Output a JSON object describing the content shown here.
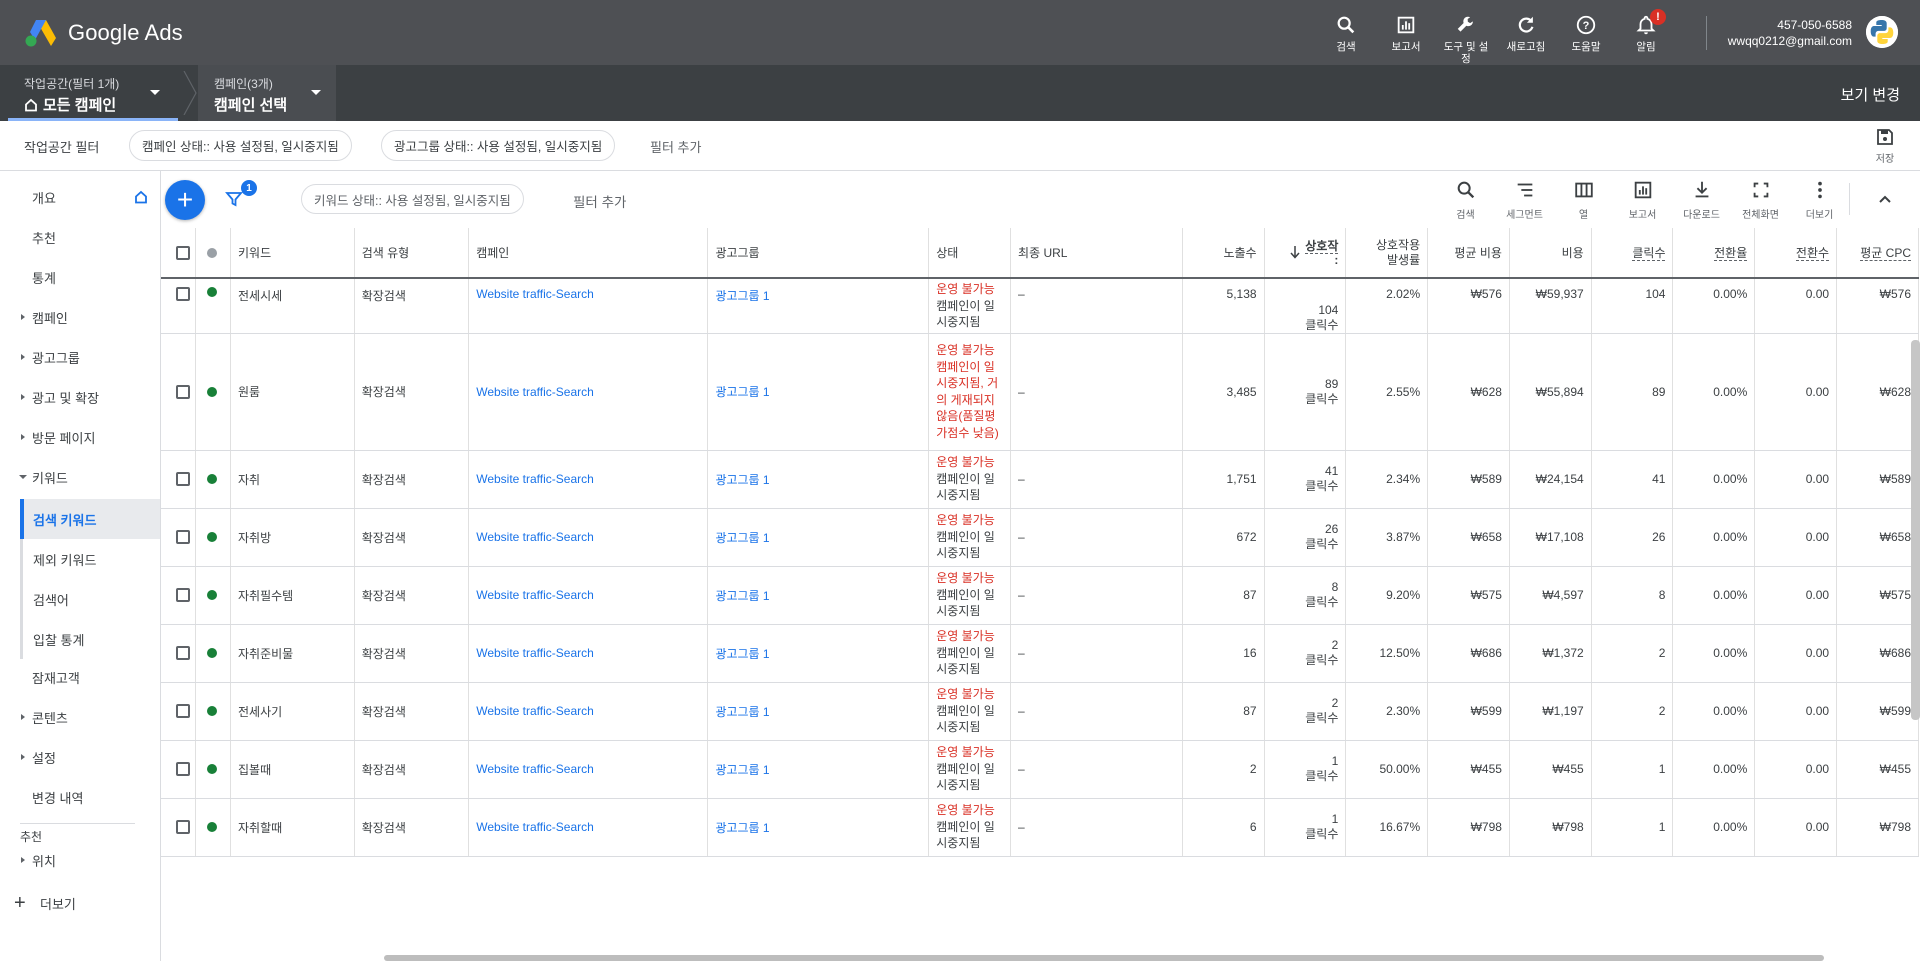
{
  "app": {
    "name": "Google Ads"
  },
  "top_actions": [
    {
      "label": "검색",
      "icon": "search-icon"
    },
    {
      "label": "보고서",
      "icon": "report-icon"
    },
    {
      "label": "도구 및 설정",
      "icon": "wrench-icon"
    },
    {
      "label": "새로고침",
      "icon": "refresh-icon"
    },
    {
      "label": "도움말",
      "icon": "help-icon"
    },
    {
      "label": "알림",
      "icon": "bell-icon",
      "badge": "!"
    }
  ],
  "account": {
    "id": "457-050-6588",
    "email": "wwqq0212@gmail.com"
  },
  "nav": {
    "workspace_small": "작업공간(필터 1개)",
    "workspace_big": "모든 캠페인",
    "campaign_small": "캠페인(3개)",
    "campaign_big": "캠페인 선택",
    "view_change": "보기 변경"
  },
  "workspace_filter": {
    "title": "작업공간 필터",
    "chips": [
      "캠페인 상태:: 사용 설정됨, 일시중지됨",
      "광고그룹 상태:: 사용 설정됨, 일시중지됨"
    ],
    "add_filter": "필터 추가",
    "save_label": "저장"
  },
  "sidebar": {
    "items": [
      {
        "label": "개요",
        "type": "top"
      },
      {
        "label": "추천",
        "type": "top"
      },
      {
        "label": "통계",
        "type": "top"
      },
      {
        "label": "캠페인",
        "type": "expand"
      },
      {
        "label": "광고그룹",
        "type": "expand"
      },
      {
        "label": "광고 및 확장",
        "type": "expand"
      },
      {
        "label": "방문 페이지",
        "type": "expand"
      },
      {
        "label": "키워드",
        "type": "expanded"
      }
    ],
    "sub_items": [
      {
        "label": "검색 키워드",
        "active": true
      },
      {
        "label": "제외 키워드",
        "active": false
      },
      {
        "label": "검색어",
        "active": false
      },
      {
        "label": "입찰 통계",
        "active": false
      }
    ],
    "items2": [
      {
        "label": "잠재고객",
        "type": "top"
      },
      {
        "label": "콘텐츠",
        "type": "expand"
      },
      {
        "label": "설정",
        "type": "expand"
      },
      {
        "label": "변경 내역",
        "type": "top"
      }
    ],
    "section_label": "추천",
    "section_item": "위치",
    "more": "더보기"
  },
  "table_toolbar": {
    "filter_badge": "1",
    "keyword_chip": "키워드 상태:: 사용 설정됨, 일시중지됨",
    "add_filter": "필터 추가",
    "tools": [
      {
        "label": "검색",
        "icon": "search-icon"
      },
      {
        "label": "세그먼트",
        "icon": "segment-icon"
      },
      {
        "label": "열",
        "icon": "columns-icon"
      },
      {
        "label": "보고서",
        "icon": "report-icon"
      },
      {
        "label": "다운로드",
        "icon": "download-icon"
      },
      {
        "label": "전체화면",
        "icon": "fullscreen-icon"
      },
      {
        "label": "더보기",
        "icon": "more-vert-icon"
      }
    ]
  },
  "table": {
    "headers": {
      "keyword": "키워드",
      "match_type": "검색 유형",
      "campaign": "캠페인",
      "ad_group": "광고그룹",
      "status": "상태",
      "final_url": "최종 URL",
      "impressions": "노출수",
      "interactions": "상호작",
      "interactions_cont": ":",
      "interaction_rate_1": "상호작용",
      "interaction_rate_2": "발생률",
      "avg_cost": "평균 비용",
      "cost": "비용",
      "clicks": "클릭수",
      "conv_rate": "전환율",
      "conversions": "전환수",
      "avg_cpc": "평균 CPC"
    },
    "rows": [
      {
        "keyword": "전세시세",
        "match": "확장검색",
        "campaign": "Website traffic-Search",
        "adgroup": "광고그룹 1",
        "status_red": "운영 불가능",
        "status_rest": "캠페인이 일시중지됨",
        "url": "–",
        "impr": "5,138",
        "inter": "104",
        "inter_unit": "클릭수",
        "rate": "2.02%",
        "avgcost": "₩576",
        "cost": "₩59,937",
        "clicks": "104",
        "convrate": "0.00%",
        "conv": "0.00",
        "cpc": "₩576"
      },
      {
        "keyword": "원룸",
        "match": "확장검색",
        "campaign": "Website traffic-Search",
        "adgroup": "광고그룹 1",
        "status_red": "운영 불가능 캠페인이 일시중지됨, 거의 게재되지 않음(품질평가점수 낮음)",
        "status_rest": "",
        "url": "–",
        "impr": "3,485",
        "inter": "89",
        "inter_unit": "클릭수",
        "rate": "2.55%",
        "avgcost": "₩628",
        "cost": "₩55,894",
        "clicks": "89",
        "convrate": "0.00%",
        "conv": "0.00",
        "cpc": "₩628"
      },
      {
        "keyword": "자취",
        "match": "확장검색",
        "campaign": "Website traffic-Search",
        "adgroup": "광고그룹 1",
        "status_red": "운영 불가능",
        "status_rest": "캠페인이 일시중지됨",
        "url": "–",
        "impr": "1,751",
        "inter": "41",
        "inter_unit": "클릭수",
        "rate": "2.34%",
        "avgcost": "₩589",
        "cost": "₩24,154",
        "clicks": "41",
        "convrate": "0.00%",
        "conv": "0.00",
        "cpc": "₩589"
      },
      {
        "keyword": "자취방",
        "match": "확장검색",
        "campaign": "Website traffic-Search",
        "adgroup": "광고그룹 1",
        "status_red": "운영 불가능",
        "status_rest": "캠페인이 일시중지됨",
        "url": "–",
        "impr": "672",
        "inter": "26",
        "inter_unit": "클릭수",
        "rate": "3.87%",
        "avgcost": "₩658",
        "cost": "₩17,108",
        "clicks": "26",
        "convrate": "0.00%",
        "conv": "0.00",
        "cpc": "₩658"
      },
      {
        "keyword": "자취필수템",
        "match": "확장검색",
        "campaign": "Website traffic-Search",
        "adgroup": "광고그룹 1",
        "status_red": "운영 불가능",
        "status_rest": "캠페인이 일시중지됨",
        "url": "–",
        "impr": "87",
        "inter": "8",
        "inter_unit": "클릭수",
        "rate": "9.20%",
        "avgcost": "₩575",
        "cost": "₩4,597",
        "clicks": "8",
        "convrate": "0.00%",
        "conv": "0.00",
        "cpc": "₩575"
      },
      {
        "keyword": "자취준비물",
        "match": "확장검색",
        "campaign": "Website traffic-Search",
        "adgroup": "광고그룹 1",
        "status_red": "운영 불가능",
        "status_rest": "캠페인이 일시중지됨",
        "url": "–",
        "impr": "16",
        "inter": "2",
        "inter_unit": "클릭수",
        "rate": "12.50%",
        "avgcost": "₩686",
        "cost": "₩1,372",
        "clicks": "2",
        "convrate": "0.00%",
        "conv": "0.00",
        "cpc": "₩686"
      },
      {
        "keyword": "전세사기",
        "match": "확장검색",
        "campaign": "Website traffic-Search",
        "adgroup": "광고그룹 1",
        "status_red": "운영 불가능",
        "status_rest": "캠페인이 일시중지됨",
        "url": "–",
        "impr": "87",
        "inter": "2",
        "inter_unit": "클릭수",
        "rate": "2.30%",
        "avgcost": "₩599",
        "cost": "₩1,197",
        "clicks": "2",
        "convrate": "0.00%",
        "conv": "0.00",
        "cpc": "₩599"
      },
      {
        "keyword": "집볼때",
        "match": "확장검색",
        "campaign": "Website traffic-Search",
        "adgroup": "광고그룹 1",
        "status_red": "운영 불가능",
        "status_rest": "캠페인이 일시중지됨",
        "url": "–",
        "impr": "2",
        "inter": "1",
        "inter_unit": "클릭수",
        "rate": "50.00%",
        "avgcost": "₩455",
        "cost": "₩455",
        "clicks": "1",
        "convrate": "0.00%",
        "conv": "0.00",
        "cpc": "₩455"
      },
      {
        "keyword": "자취할때",
        "match": "확장검색",
        "campaign": "Website traffic-Search",
        "adgroup": "광고그룹 1",
        "status_red": "운영 불가능",
        "status_rest": "캠페인이 일시중지됨",
        "url": "–",
        "impr": "6",
        "inter": "1",
        "inter_unit": "클릭수",
        "rate": "16.67%",
        "avgcost": "₩798",
        "cost": "₩798",
        "clicks": "1",
        "convrate": "0.00%",
        "conv": "0.00",
        "cpc": "₩798"
      }
    ]
  },
  "colors": {
    "topbar": "#4e5054",
    "navbar": "#3c4043",
    "accent": "#1a73e8",
    "status_red": "#d93025",
    "enabled_green": "#188038"
  }
}
